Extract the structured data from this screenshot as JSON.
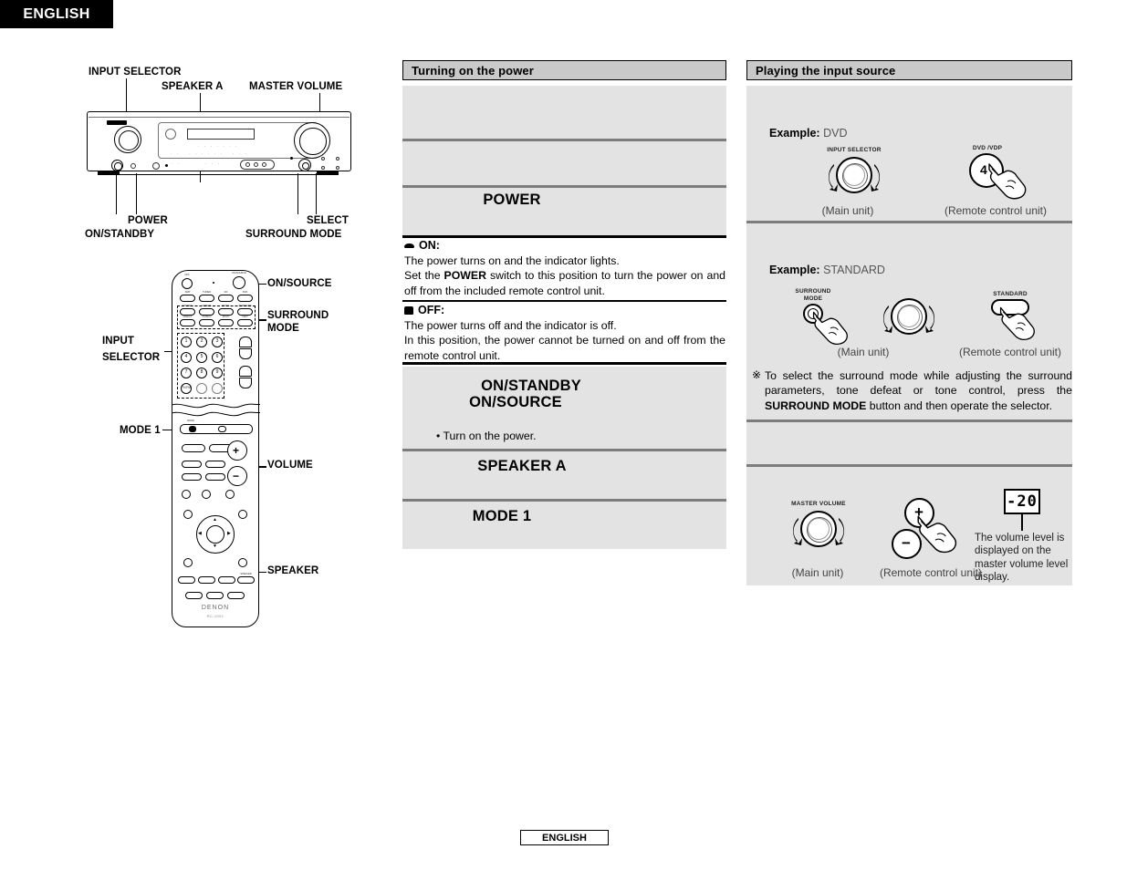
{
  "page": {
    "language_tab": "ENGLISH",
    "footer_tab": "ENGLISH"
  },
  "diagrams": {
    "main_unit": {
      "callouts": [
        {
          "id": "input-selector",
          "label": "INPUT SELECTOR"
        },
        {
          "id": "speaker-a",
          "label": "SPEAKER A"
        },
        {
          "id": "master-volume",
          "label": "MASTER VOLUME"
        },
        {
          "id": "power",
          "label": "POWER"
        },
        {
          "id": "on-standby",
          "label": "ON/STANDBY"
        },
        {
          "id": "select",
          "label": "SELECT"
        },
        {
          "id": "surround-mode",
          "label": "SURROUND MODE"
        }
      ]
    },
    "remote_unit": {
      "brand": "DENON",
      "model": "RC-1001",
      "callouts": [
        {
          "id": "on-source",
          "label": "ON/SOURCE"
        },
        {
          "id": "surround-mode",
          "label": "SURROUND\nMODE"
        },
        {
          "id": "surround-mode-l1",
          "label": "SURROUND"
        },
        {
          "id": "surround-mode-l2",
          "label": "MODE"
        },
        {
          "id": "input-selector-l1",
          "label": "INPUT"
        },
        {
          "id": "input-selector-l2",
          "label": "SELECTOR"
        },
        {
          "id": "mode-1",
          "label": "MODE 1"
        },
        {
          "id": "volume",
          "label": "VOLUME"
        },
        {
          "id": "speaker",
          "label": "SPEAKER"
        }
      ],
      "keypad": [
        "1",
        "2",
        "3",
        "4",
        "5",
        "6",
        "7",
        "8",
        "9",
        "0",
        "+10"
      ],
      "keypad_tv_fm": "TV/FM"
    }
  },
  "power_panel": {
    "title": "Turning on the power",
    "caption_power": "POWER",
    "on": {
      "label": "ON:",
      "icon": "switch-pressed-icon",
      "lines": [
        "The power turns on and the indicator lights.",
        "Set the POWER switch to this position to turn the power on and off from the included remote control unit."
      ],
      "line1": "The power turns on and the indicator lights.",
      "line2_pre": "Set the ",
      "line2_bold": "POWER",
      "line2_post": " switch to this position to turn the power on and off from the included remote control unit."
    },
    "off": {
      "label": "OFF:",
      "icon": "switch-raised-icon",
      "line1": "The power turns off and the indicator is off.",
      "line2": "In this position, the power cannot be turned on and off from the remote control unit."
    },
    "caption_on_standby_l1": "ON/STANDBY",
    "caption_on_standby_l2": "ON/SOURCE",
    "bullet_turn_on": "• Turn on the power.",
    "caption_speaker_a": "SPEAKER A",
    "caption_mode_1": "MODE 1"
  },
  "input_panel": {
    "title": "Playing the input source",
    "example_dvd": {
      "label": "Example:",
      "value": "DVD",
      "main_knob_cap": "INPUT SELECTOR",
      "remote_btn_cap": "DVD /VDP",
      "remote_btn_num": "4",
      "main_unit_caption": "(Main unit)",
      "remote_unit_caption": "(Remote control unit)"
    },
    "example_standard": {
      "label": "Example:",
      "value": "STANDARD",
      "main_btn_cap_l1": "SURROUND",
      "main_btn_cap_l2": "MODE",
      "remote_btn_cap": "STANDARD",
      "main_unit_caption": "(Main unit)",
      "remote_unit_caption": "(Remote control unit)"
    },
    "note": {
      "mark": "※",
      "pre": "To select the surround mode while adjusting the surround parameters, tone defeat or tone control, press the ",
      "bold": "SURROUND MODE",
      "post": " button and then operate the selector."
    },
    "volume_row": {
      "main_knob_cap": "MASTER VOLUME",
      "plus": "+",
      "minus": "−",
      "main_unit_caption": "(Main unit)",
      "remote_unit_caption": "(Remote control unit)",
      "lcd_value": "-20",
      "lcd_note": "The volume level is displayed on the master volume level display."
    }
  },
  "colors": {
    "panel_header_bg": "#c9c9c9",
    "panel_body_bg": "#e3e3e3",
    "divider": "#7d7d7d",
    "ink": "#000000"
  }
}
